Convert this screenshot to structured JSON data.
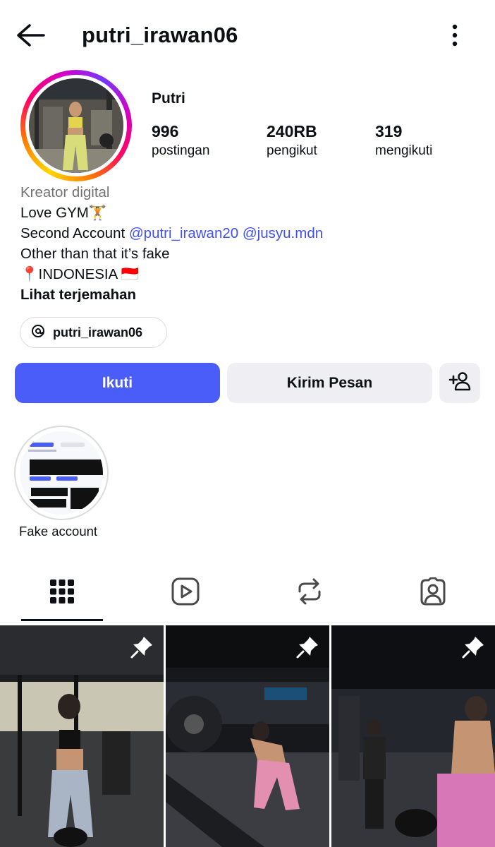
{
  "header": {
    "username": "putri_irawan06",
    "back_icon": "arrow-left-icon",
    "more_icon": "more-vertical-icon"
  },
  "profile": {
    "display_name": "Putri",
    "stats": [
      {
        "value": "996",
        "label": "postingan"
      },
      {
        "value": "240RB",
        "label": "pengikut"
      },
      {
        "value": "319",
        "label": "mengikuti"
      }
    ]
  },
  "bio": {
    "category": "Kreator digital",
    "line1": "Love GYM🏋",
    "line2_prefix": "Second Account ",
    "mention1": "@putri_irawan20",
    "mention2": "@jusyu.mdn",
    "line3": "Other than that it’s fake",
    "line4": "📍INDONESIA 🇮🇩",
    "translate": "Lihat terjemahan"
  },
  "threads_chip": {
    "label": "putri_irawan06",
    "icon": "threads-icon"
  },
  "actions": {
    "follow": "Ikuti",
    "message": "Kirim Pesan",
    "add_user_icon": "add-user-icon"
  },
  "highlights": [
    {
      "label": "Fake account"
    }
  ],
  "tabs": [
    {
      "icon": "grid-icon",
      "active": true
    },
    {
      "icon": "reels-icon",
      "active": false
    },
    {
      "icon": "reposts-icon",
      "active": false
    },
    {
      "icon": "tagged-icon",
      "active": false
    }
  ],
  "posts": [
    {
      "pinned": true
    },
    {
      "pinned": true
    },
    {
      "pinned": true
    }
  ],
  "colors": {
    "follow_button": "#4a5df9",
    "link": "#4150f7",
    "secondary_button": "#efeff3"
  }
}
